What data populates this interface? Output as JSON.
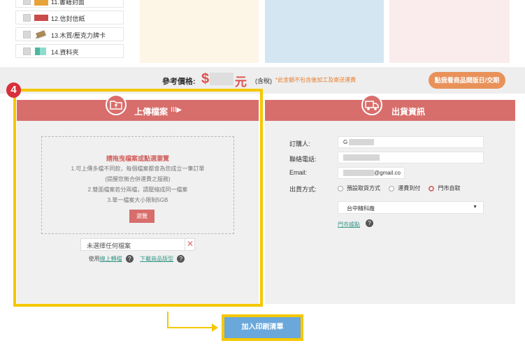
{
  "products": [
    {
      "label": "11.書籍封面",
      "thumb_color": "#e8a23a",
      "icon": "book-cover-icon"
    },
    {
      "label": "12.信封信紙",
      "thumb_color": "#c94b4b",
      "icon": "envelope-icon"
    },
    {
      "label": "13.木質/壓克力牌卡",
      "thumb_color": "#8c6b3e",
      "icon": "card-icon"
    },
    {
      "label": "14.資料夾",
      "thumb_color": "#5fc3b0",
      "icon": "folder-icon"
    }
  ],
  "panels": {
    "colors": [
      "#fdf5e6",
      "#d4e6f1",
      "#faecec"
    ]
  },
  "price": {
    "label": "參考價格:",
    "currency": "$",
    "unit": "元",
    "tax": "(含稅)",
    "note": "*此金額不包含後加工及寄送運費",
    "dates_button": "點我看商品開版日/交期"
  },
  "upload": {
    "step": "4",
    "title": "上傳檔案",
    "arrows": "III▶",
    "drop_title": "請拖曳檔案或點選瀏覽",
    "drop_lines": [
      "1.可上傳多檔不同款，每個檔案都會為您成立一筆訂單",
      "(提醒您無合併運費之服務)",
      "2.雙面檔案若分兩檔，請壓縮成同一檔案",
      "3.單一檔案大小限制5GB"
    ],
    "browse_label": "瀏覽",
    "file_placeholder": "未選擇任何檔案",
    "clear_symbol": "✕",
    "help_prefix": "使用",
    "help_link_1": "線上轉檔",
    "help_link_2": "下載商品版型",
    "help_symbol": "?"
  },
  "shipping": {
    "title": "出貨資訊",
    "orderer_label": "訂購人:",
    "orderer_value": "G",
    "phone_label": "聯絡電話:",
    "email_label": "Email:",
    "email_value": "@gmail.co",
    "method_label": "出貨方式:",
    "methods": [
      "預設取貨方式",
      "運費到付",
      "門市自取"
    ],
    "selected_method": "門市自取",
    "store_value": "台中精科廠",
    "store_link": "門市據點"
  },
  "add_button": "加入印刷清單",
  "colors": {
    "header_red": "#d86e6b",
    "highlight_yellow": "#f5c800",
    "price_red": "#e0504d",
    "orange_button": "#e8925a",
    "blue_button": "#6aa8dc",
    "link_teal": "#3c9a8a"
  }
}
